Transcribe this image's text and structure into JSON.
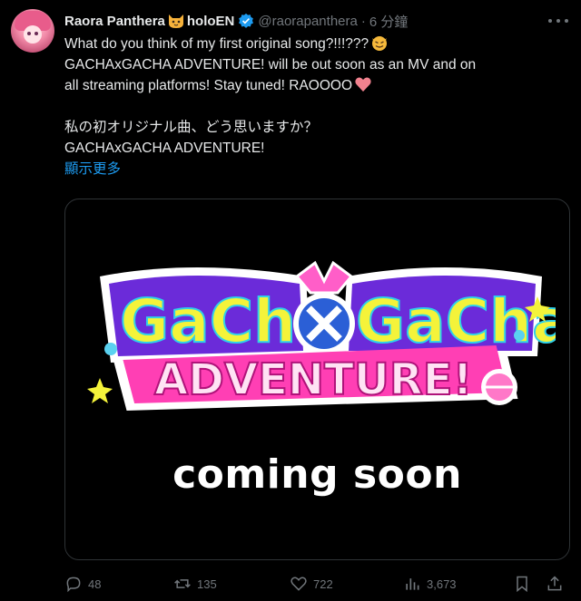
{
  "author": {
    "display_name": "Raora Panthera",
    "name_suffix": "holoEN",
    "handle": "@raorapanthera",
    "separator": "·",
    "time": "6 分鐘"
  },
  "tweet": {
    "line1": "What do you think of my first original song?!!!???",
    "line2": "GACHAxGACHA ADVENTURE! will be out soon as an MV and on",
    "line3": "all streaming platforms! Stay tuned! RAOOOO",
    "line4": "私の初オリジナル曲、どう思いますか？",
    "line5": "GACHAxGACHA ADVENTURE!",
    "show_more": "顯示更多"
  },
  "media": {
    "logo_top": "GaCha",
    "logo_top_right": "GaCha",
    "logo_bottom": "ADVENTURE!",
    "caption": "coming soon"
  },
  "actions": {
    "replies": "48",
    "reposts": "135",
    "likes": "722",
    "views": "3,673"
  },
  "colors": {
    "accent": "#1d9bf0",
    "muted": "#71767b",
    "logo_pink": "#ff3fb4",
    "logo_yellow": "#f4f33a",
    "logo_purple": "#6b2bd9"
  },
  "icons": [
    "cat-emoji-icon",
    "verified-badge-icon",
    "more-icon",
    "devil-emoji-icon",
    "heart-emoji-icon",
    "reply-icon",
    "repost-icon",
    "like-icon",
    "views-icon",
    "bookmark-icon",
    "share-icon"
  ]
}
